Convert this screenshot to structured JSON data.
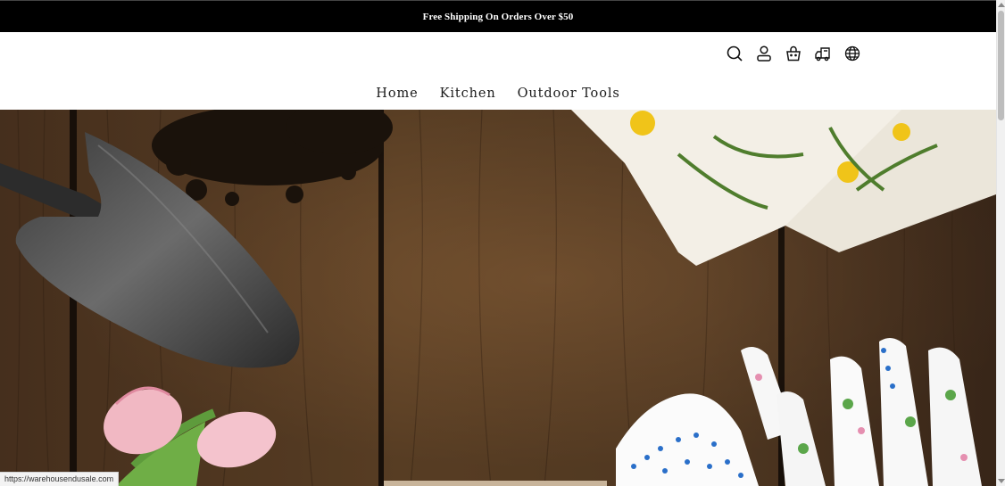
{
  "announcement": "Free Shipping On Orders Over $50",
  "header": {
    "icons": [
      "search-icon",
      "account-icon",
      "cart-icon",
      "delivery-truck-icon",
      "globe-icon"
    ]
  },
  "nav": {
    "items": [
      {
        "label": "Home"
      },
      {
        "label": "Kitchen"
      },
      {
        "label": "Outdoor Tools"
      }
    ]
  },
  "status_bar": {
    "url": "https://warehousendusale.com"
  },
  "colors": {
    "announcement_bg": "#000000",
    "announcement_text": "#ffffff",
    "nav_text": "#1a1a1a",
    "wood": "#6b4a2e"
  }
}
